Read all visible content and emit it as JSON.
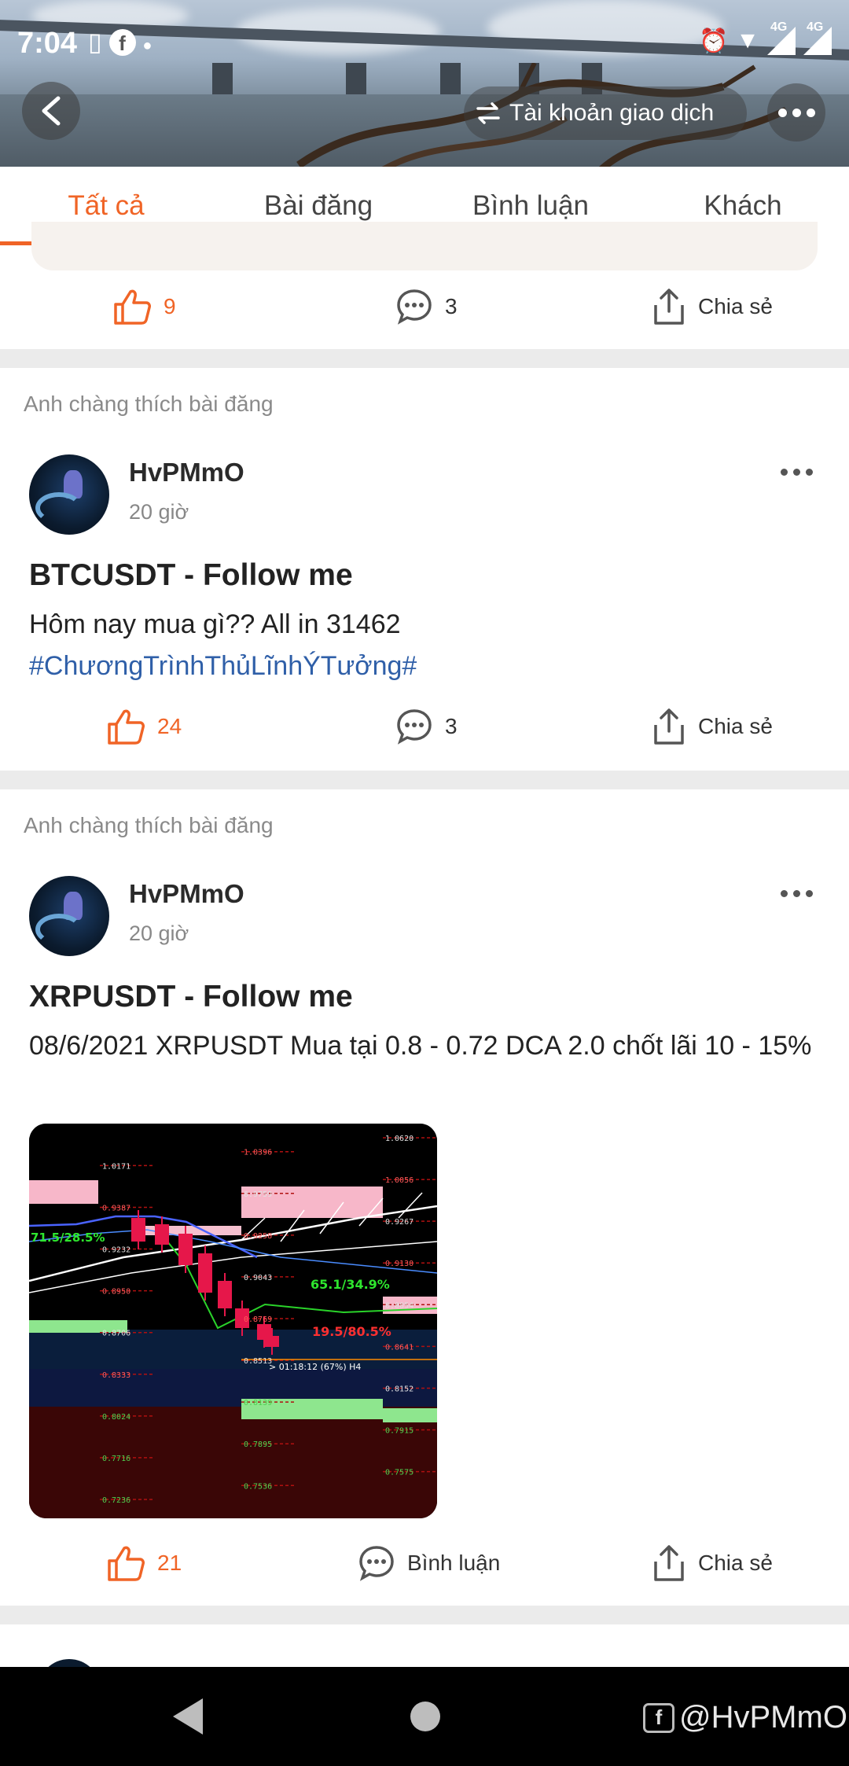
{
  "status_bar": {
    "time": "7:04",
    "network_left": "4G",
    "network_right": "4G"
  },
  "header": {
    "account_label": "Tài khoản giao dịch"
  },
  "tabs": [
    {
      "label": "Tất cả",
      "active": true
    },
    {
      "label": "Bài đăng",
      "active": false
    },
    {
      "label": "Bình luận",
      "active": false
    },
    {
      "label": "Khách",
      "active": false
    }
  ],
  "posts": [
    {
      "likes": "9",
      "comments": "3",
      "share_label": "Chia sẻ"
    },
    {
      "liked_by": "Anh chàng thích bài đăng",
      "user_name": "HvPMmO",
      "time": "20 giờ",
      "title": "BTCUSDT - Follow me",
      "body": "Hôm nay mua gì?? All in 31462",
      "hashtag": "#ChươngTrìnhThủLĩnhÝTưởng#",
      "likes": "24",
      "comments": "3",
      "share_label": "Chia sẻ"
    },
    {
      "liked_by": "Anh chàng thích bài đăng",
      "user_name": "HvPMmO",
      "time": "20 giờ",
      "title": "XRPUSDT - Follow me",
      "body": "08/6/2021 XRPUSDT Mua tại 0.8 - 0.72 DCA 2.0 chốt lãi 10 - 15%",
      "likes": "21",
      "comment_label": "Bình luận",
      "share_label": "Chia sẻ",
      "chart_image": {
        "price_labels": [
          "1.0620",
          "1.0396",
          "1.0171",
          "1.0056",
          "0.9759",
          "0.9387",
          "0.9267",
          "0.9258",
          "0.9232",
          "0.9130",
          "0.9043",
          "0.8950",
          "0.8854",
          "0.8769",
          "0.8706",
          "0.8641",
          "0.8513",
          "0.8333",
          "0.8152",
          "0.8139",
          "0.8024",
          "0.7915",
          "0.7895",
          "0.7716",
          "0.7575",
          "0.7536",
          "0.7236"
        ],
        "annotations": [
          "71.5/28.5%",
          "65.1/34.9%",
          "19.5/80.5%",
          "> 01:18:12 (67%) H4"
        ]
      }
    }
  ],
  "watermark": "@HvPMmO",
  "colors": {
    "accent": "#f06426",
    "hashtag": "#2f5fa8",
    "background": "#ebebeb"
  }
}
